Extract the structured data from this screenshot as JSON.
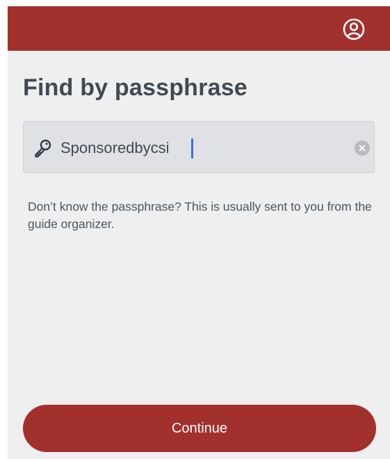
{
  "header": {
    "background_color": "#a2302d",
    "profile_icon": "user-circle-icon"
  },
  "page": {
    "title": "Find by passphrase"
  },
  "search": {
    "leading_icon": "key-icon",
    "value": "Sponsoredbycsi",
    "clear_icon": "clear-circle-icon"
  },
  "help": {
    "text": "Don’t know the passphrase? This is usually sent to you from the guide organizer."
  },
  "actions": {
    "continue_label": "Continue",
    "button_color": "#a2302d"
  }
}
